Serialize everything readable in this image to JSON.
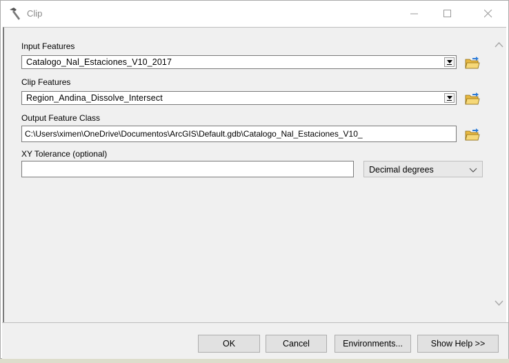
{
  "window": {
    "title": "Clip"
  },
  "fields": {
    "input_features": {
      "label": "Input Features",
      "value": "Catalogo_Nal_Estaciones_V10_2017"
    },
    "clip_features": {
      "label": "Clip Features",
      "value": "Region_Andina_Dissolve_Intersect"
    },
    "output_feature_class": {
      "label": "Output Feature Class",
      "value": "C:\\Users\\ximen\\OneDrive\\Documentos\\ArcGIS\\Default.gdb\\Catalogo_Nal_Estaciones_V10_"
    },
    "xy_tolerance": {
      "label": "XY Tolerance (optional)",
      "value": "",
      "unit": "Decimal degrees"
    }
  },
  "buttons": {
    "ok": "OK",
    "cancel": "Cancel",
    "environments": "Environments...",
    "show_help": "Show Help >>"
  },
  "icons": {
    "title": "hammer-icon",
    "browse": "open-folder-icon"
  },
  "colors": {
    "folder": "#e8b840",
    "folder_arrow": "#2a7ad8",
    "window_bg": "#f0f0f0"
  }
}
